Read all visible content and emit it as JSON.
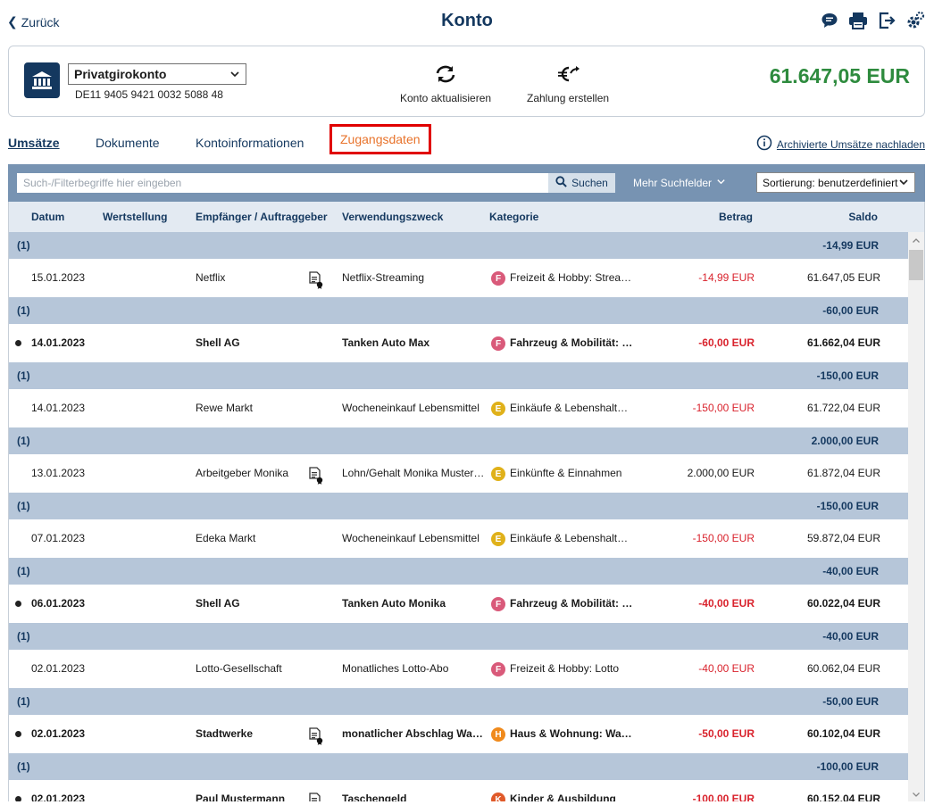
{
  "header": {
    "back_label": "Zurück",
    "title": "Konto",
    "icons": [
      "chat-icon",
      "print-icon",
      "logout-icon",
      "settings-icon"
    ]
  },
  "account": {
    "name": "Privatgirokonto",
    "iban": "DE11 9405 9421 0032 5088 48",
    "refresh_label": "Konto aktualisieren",
    "payment_label": "Zahlung erstellen",
    "balance": "61.647,05 EUR",
    "balance_color": "#2e8b3e"
  },
  "tabs": {
    "umsaetze": "Umsätze",
    "dokumente": "Dokumente",
    "kontoinfo": "Kontoinformationen",
    "zugangsdaten": "Zugangsdaten",
    "archive_link": "Archivierte Umsätze nachladen"
  },
  "search": {
    "placeholder": "Such-/Filterbegriffe hier eingeben",
    "value": "",
    "button_label": "Suchen",
    "more_fields": "Mehr Suchfelder",
    "sort_value": "Sortierung: benutzerdefiniert"
  },
  "columns": {
    "datum": "Datum",
    "wertstellung": "Wertstellung",
    "empfaenger": "Empfänger / Auftraggeber",
    "verwendungszweck": "Verwendungszweck",
    "kategorie": "Kategorie",
    "betrag": "Betrag",
    "saldo": "Saldo"
  },
  "groups": [
    {
      "count": "(1)",
      "sum": "-14,99 EUR",
      "tx": {
        "date": "15.01.2023",
        "payee": "Netflix",
        "doc": true,
        "purpose": "Netflix-Streaming",
        "cat_letter": "F",
        "cat_color": "#d95a7a",
        "category": "Freizeit & Hobby: Streaming",
        "amount": "-14,99 EUR",
        "negative": true,
        "saldo": "61.647,05 EUR",
        "unread": false
      }
    },
    {
      "count": "(1)",
      "sum": "-60,00 EUR",
      "tx": {
        "date": "14.01.2023",
        "payee": "Shell AG",
        "doc": false,
        "purpose": "Tanken Auto Max",
        "cat_letter": "F",
        "cat_color": "#d95a7a",
        "category": "Fahrzeug & Mobilität: Tanken",
        "amount": "-60,00 EUR",
        "negative": true,
        "saldo": "61.662,04 EUR",
        "unread": true
      }
    },
    {
      "count": "(1)",
      "sum": "-150,00 EUR",
      "tx": {
        "date": "14.01.2023",
        "payee": "Rewe Markt",
        "doc": false,
        "purpose": "Wocheneinkauf Lebensmittel",
        "cat_letter": "E",
        "cat_color": "#e0b11a",
        "category": "Einkäufe & Lebenshaltung",
        "amount": "-150,00 EUR",
        "negative": true,
        "saldo": "61.722,04 EUR",
        "unread": false
      }
    },
    {
      "count": "(1)",
      "sum": "2.000,00 EUR",
      "tx": {
        "date": "13.01.2023",
        "payee": "Arbeitgeber Monika",
        "doc": true,
        "purpose": "Lohn/Gehalt Monika Mustermann",
        "cat_letter": "E",
        "cat_color": "#e0b11a",
        "category": "Einkünfte & Einnahmen",
        "amount": "2.000,00 EUR",
        "negative": false,
        "saldo": "61.872,04 EUR",
        "unread": false
      }
    },
    {
      "count": "(1)",
      "sum": "-150,00 EUR",
      "tx": {
        "date": "07.01.2023",
        "payee": "Edeka Markt",
        "doc": false,
        "purpose": "Wocheneinkauf Lebensmittel",
        "cat_letter": "E",
        "cat_color": "#e0b11a",
        "category": "Einkäufe & Lebenshaltung",
        "amount": "-150,00 EUR",
        "negative": true,
        "saldo": "59.872,04 EUR",
        "unread": false
      }
    },
    {
      "count": "(1)",
      "sum": "-40,00 EUR",
      "tx": {
        "date": "06.01.2023",
        "payee": "Shell AG",
        "doc": false,
        "purpose": "Tanken Auto Monika",
        "cat_letter": "F",
        "cat_color": "#d95a7a",
        "category": "Fahrzeug & Mobilität: Tanken",
        "amount": "-40,00 EUR",
        "negative": true,
        "saldo": "60.022,04 EUR",
        "unread": true
      }
    },
    {
      "count": "(1)",
      "sum": "-40,00 EUR",
      "tx": {
        "date": "02.01.2023",
        "payee": "Lotto-Gesellschaft",
        "doc": false,
        "purpose": "Monatliches Lotto-Abo",
        "cat_letter": "F",
        "cat_color": "#d95a7a",
        "category": "Freizeit & Hobby: Lotto",
        "amount": "-40,00 EUR",
        "negative": true,
        "saldo": "60.062,04 EUR",
        "unread": false
      }
    },
    {
      "count": "(1)",
      "sum": "-50,00 EUR",
      "tx": {
        "date": "02.01.2023",
        "payee": "Stadtwerke",
        "doc": true,
        "purpose": "monatlicher Abschlag Wasser",
        "cat_letter": "H",
        "cat_color": "#f08a1c",
        "category": "Haus & Wohnung: Wasser",
        "amount": "-50,00 EUR",
        "negative": true,
        "saldo": "60.102,04 EUR",
        "unread": true
      }
    },
    {
      "count": "(1)",
      "sum": "-100,00 EUR",
      "tx": {
        "date": "02.01.2023",
        "payee": "Paul Mustermann",
        "doc": true,
        "purpose": "Taschengeld",
        "cat_letter": "K",
        "cat_color": "#e05a2a",
        "category": "Kinder & Ausbildung",
        "amount": "-100,00 EUR",
        "negative": true,
        "saldo": "60.152,04 EUR",
        "unread": true
      }
    }
  ]
}
